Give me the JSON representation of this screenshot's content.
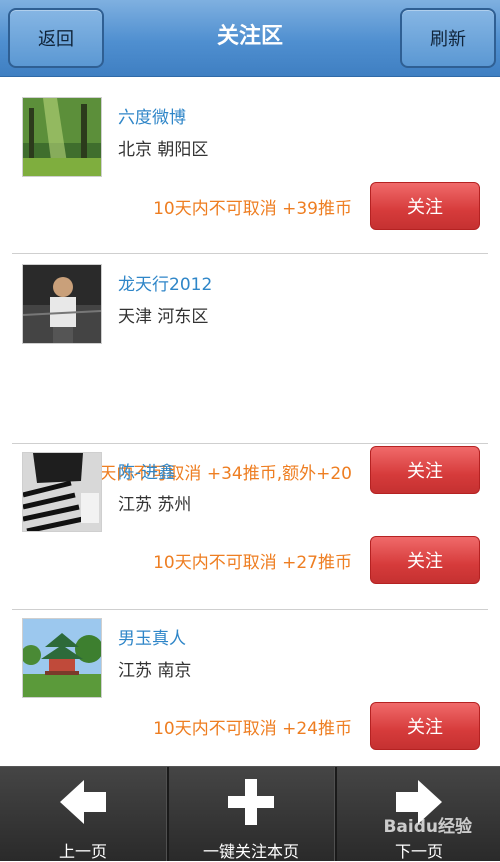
{
  "header": {
    "back_label": "返回",
    "title": "关注区",
    "refresh_label": "刷新"
  },
  "items": [
    {
      "name": "六度微博",
      "location": "北京 朝阳区",
      "promo": "10天内不可取消   +39推币",
      "follow_label": "关注"
    },
    {
      "name": "龙天行2012",
      "location": "天津 河东区",
      "promo": "30天内不可取消   +34推币,额外+20",
      "follow_label": "关注"
    },
    {
      "name": "陈-进鑫",
      "location": "江苏 苏州",
      "promo": "10天内不可取消   +27推币",
      "follow_label": "关注"
    },
    {
      "name": "男玉真人",
      "location": "江苏 南京",
      "promo": "10天内不可取消   +24推币",
      "follow_label": "关注"
    }
  ],
  "bottom": {
    "prev_label": "上一页",
    "follow_all_label": "一键关注本页",
    "next_label": "下一页"
  },
  "watermark": "Baidu经验",
  "colors": {
    "header": "#4f8fd0",
    "name": "#2f86c8",
    "promo": "#ee7e22",
    "follow_button": "#d63b3b"
  }
}
